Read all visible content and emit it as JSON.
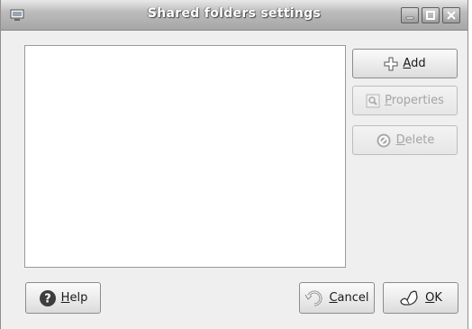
{
  "window": {
    "title": "Shared folders settings",
    "menu_icon": "window-menu-icon",
    "controls": [
      "minimize-icon",
      "maximize-icon",
      "close-icon"
    ]
  },
  "shares_list": {
    "items": []
  },
  "buttons": {
    "add": {
      "mnemonic": "A",
      "rest": "dd",
      "icon": "add-icon",
      "enabled": true
    },
    "properties": {
      "mnemonic": "P",
      "rest": "roperties",
      "icon": "properties-icon",
      "enabled": false
    },
    "delete": {
      "mnemonic": "D",
      "rest": "elete",
      "icon": "delete-icon",
      "enabled": false
    },
    "help": {
      "mnemonic": "H",
      "rest": "elp",
      "icon": "help-icon"
    },
    "cancel": {
      "mnemonic": "C",
      "rest": "ancel",
      "icon": "cancel-icon"
    },
    "ok": {
      "mnemonic": "O",
      "rest": "K",
      "icon": "ok-icon"
    }
  },
  "colors": {
    "dialog_bg": "#efefef",
    "titlebar_top": "#e8e8e8",
    "titlebar_bottom": "#a6a6a6",
    "help_icon": "#3d3d3d"
  }
}
